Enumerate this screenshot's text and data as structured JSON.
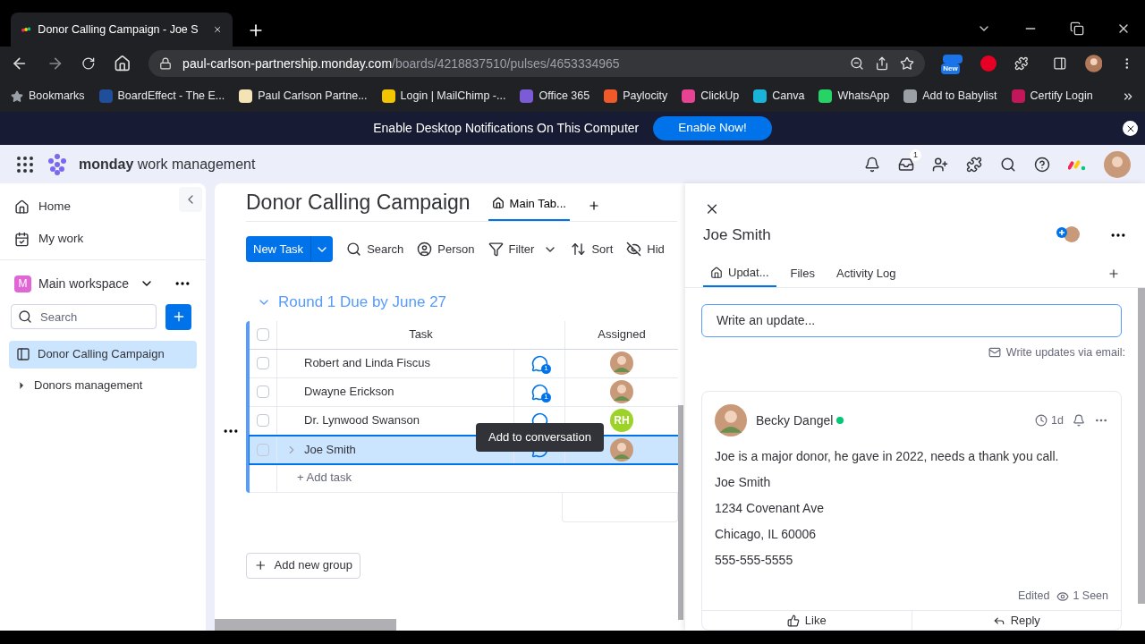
{
  "browser": {
    "tab_title": "Donor Calling Campaign - Joe S",
    "url_host": "paul-carlson-partnership.monday.com",
    "url_path": "/boards/4218837510/pulses/4653334965",
    "extension_badge": "New",
    "bookmarks": [
      {
        "label": "Bookmarks",
        "kind": "star"
      },
      {
        "label": "BoardEffect - The E...",
        "kind": "site",
        "color": "#1f4e9a"
      },
      {
        "label": "Paul Carlson Partne...",
        "kind": "site",
        "color": "#f3e3b5"
      },
      {
        "label": "Login | MailChimp -...",
        "kind": "site",
        "color": "#f2c500"
      },
      {
        "label": "Office 365",
        "kind": "site",
        "color": "#7b5cd6"
      },
      {
        "label": "Paylocity",
        "kind": "site",
        "color": "#f05a28"
      },
      {
        "label": "ClickUp",
        "kind": "site",
        "color": "#e84393"
      },
      {
        "label": "Canva",
        "kind": "site",
        "color": "#19b4d8"
      },
      {
        "label": "WhatsApp",
        "kind": "site",
        "color": "#25d366"
      },
      {
        "label": "Add to Babylist",
        "kind": "site",
        "color": "#9aa0a6"
      },
      {
        "label": "Certify Login",
        "kind": "site",
        "color": "#c2185b"
      }
    ]
  },
  "banner": {
    "text": "Enable Desktop Notifications On This Computer",
    "button": "Enable Now!"
  },
  "header": {
    "brand": "monday",
    "product": "work management",
    "inbox_count": "1"
  },
  "sidebar": {
    "nav": [
      {
        "label": "Home",
        "kind": "home"
      },
      {
        "label": "My work",
        "kind": "calendar"
      }
    ],
    "workspace": {
      "initial": "M",
      "name": "Main workspace"
    },
    "search_placeholder": "Search",
    "boards": [
      {
        "label": "Donor Calling Campaign",
        "kind": "board",
        "selected": true
      },
      {
        "label": "Donors management",
        "kind": "folder",
        "selected": false
      }
    ]
  },
  "board": {
    "title": "Donor Calling Campaign",
    "views": [
      {
        "label": "Main Tab...",
        "selected": true
      }
    ],
    "primary_button": "New Task",
    "tools": [
      {
        "label": "Search",
        "kind": "search"
      },
      {
        "label": "Person",
        "kind": "person"
      },
      {
        "label": "Filter",
        "kind": "filter"
      },
      {
        "label": "Sort",
        "kind": "sort"
      },
      {
        "label": "Hid",
        "kind": "hide"
      }
    ],
    "group": {
      "title": "Round 1 Due by June 27",
      "expanded": true
    },
    "columns": [
      "Task",
      "Assigned"
    ],
    "all_checked": false,
    "rows": [
      {
        "name": "Robert and Linda Fiscus",
        "checked": false,
        "selected": false,
        "updates": "1",
        "assignee": {
          "kind": "photo"
        }
      },
      {
        "name": "Dwayne Erickson",
        "checked": false,
        "selected": false,
        "updates": "1",
        "assignee": {
          "kind": "photo"
        }
      },
      {
        "name": "Dr. Lynwood Swanson",
        "checked": false,
        "selected": false,
        "assignee": {
          "kind": "initials",
          "initials": "RH",
          "color": "#9cd326"
        }
      },
      {
        "name": "Joe Smith",
        "checked": false,
        "selected": true,
        "assignee": {
          "kind": "photo"
        }
      }
    ],
    "add_task": "+ Add task",
    "tooltip": "Add to conversation",
    "add_group": "Add new group"
  },
  "item_panel": {
    "title": "Joe Smith",
    "tabs": [
      {
        "label": "Updat...",
        "kind": "home",
        "selected": true
      },
      {
        "label": "Files",
        "selected": false
      },
      {
        "label": "Activity Log",
        "selected": false
      }
    ],
    "update_placeholder": "Write an update...",
    "email_link": "Write updates via email:",
    "post": {
      "author": "Becky Dangel",
      "online": true,
      "time": "1d",
      "lines": [
        "Joe is a major donor, he gave in 2022, needs a thank you call.",
        "Joe Smith",
        "1234 Covenant Ave",
        "Chicago, IL 60006",
        "555-555-5555"
      ],
      "edited": "Edited",
      "seen": "1 Seen",
      "actions": [
        "Like",
        "Reply"
      ]
    }
  }
}
